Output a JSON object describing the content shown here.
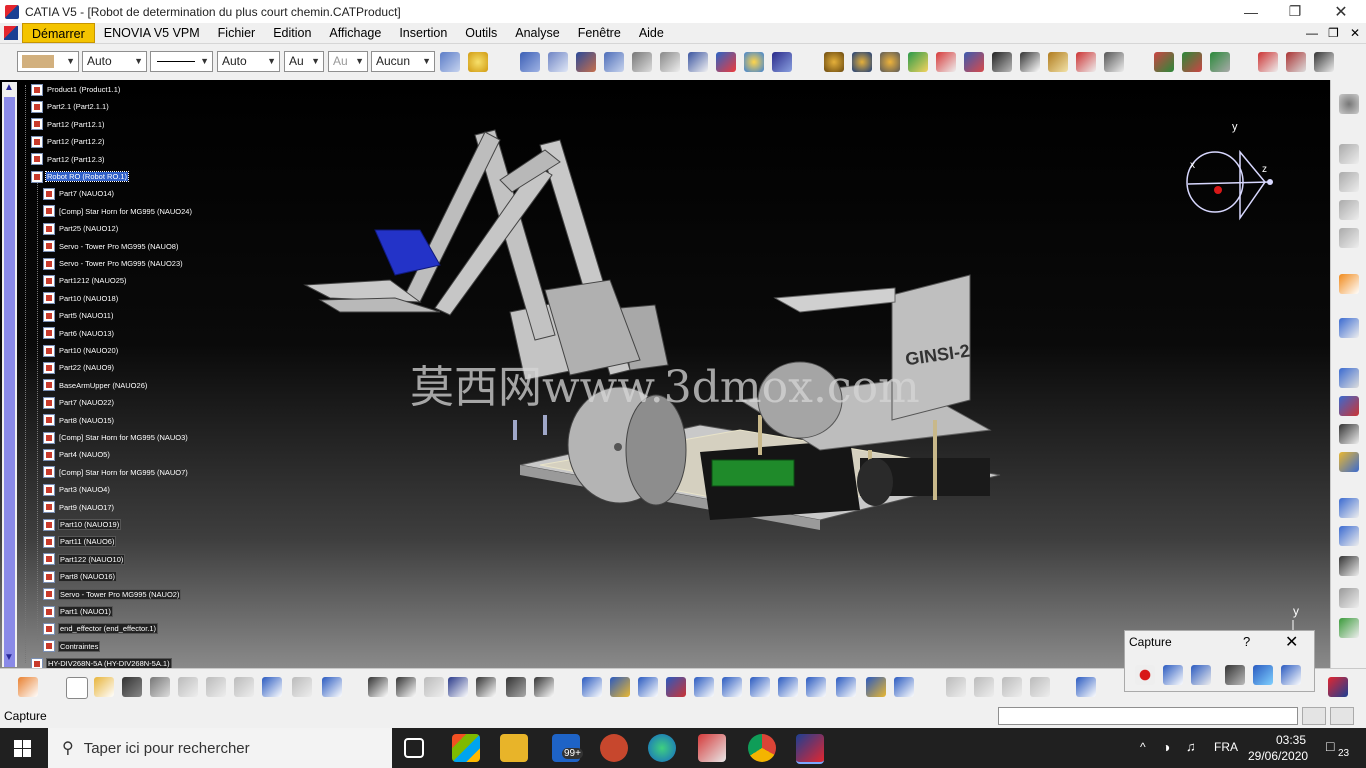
{
  "window": {
    "title": "CATIA V5 - [Robot de determination du plus court chemin.CATProduct]"
  },
  "menu": {
    "items": [
      "Démarrer",
      "ENOVIA V5 VPM",
      "Fichier",
      "Edition",
      "Affichage",
      "Insertion",
      "Outils",
      "Analyse",
      "Fenêtre",
      "Aide"
    ]
  },
  "toolbar": {
    "line_style": "Auto",
    "thickness": "Auto",
    "combo_a": "Au",
    "combo_b": "Au",
    "layer": "Aucun"
  },
  "tree": {
    "items": [
      "Product1 (Product1.1)",
      "Part2.1 (Part2.1.1)",
      "Part12 (Part12.1)",
      "Part12 (Part12.2)",
      "Part12 (Part12.3)",
      "Robot RO (Robot RO.1)",
      "Part7 (NAUO14)",
      "[Comp] Star Horn for MG995 (NAUO24)",
      "Part25 (NAUO12)",
      "Servo - Tower Pro MG995 (NAUO8)",
      "Servo - Tower Pro MG995 (NAUO23)",
      "Part1212 (NAUO25)",
      "Part10 (NAUO18)",
      "Part5 (NAUO11)",
      "Part6 (NAUO13)",
      "Part10 (NAUO20)",
      "Part22 (NAUO9)",
      "BaseArmUpper (NAUO26)",
      "Part7 (NAUO22)",
      "Part8 (NAUO15)",
      "[Comp] Star Horn for MG995 (NAUO3)",
      "Part4 (NAUO5)",
      "[Comp] Star Horn for MG995 (NAUO7)",
      "Part3 (NAUO4)",
      "Part9 (NAUO17)",
      "Part10 (NAUO19)",
      "Part11 (NAUO6)",
      "Part122 (NAUO10)",
      "Part8 (NAUO16)",
      "Servo - Tower Pro MG995 (NAUO2)",
      "Part1 (NAUO1)",
      "end_effector (end_effector.1)",
      "Contraintes",
      "HY-DIV268N-5A (HY-DIV268N-5A.1)"
    ]
  },
  "viewport": {
    "watermark": "莫西网www.3dmox.com",
    "board_label": "GINSI-2",
    "compass": {
      "x": "x",
      "y": "y",
      "z": "z"
    },
    "axis_y": "y"
  },
  "capture_toolbar": {
    "title": "Capture",
    "help": "?",
    "close": "✕"
  },
  "status": {
    "text": "Capture"
  },
  "taskbar": {
    "search_placeholder": "Taper ici pour rechercher",
    "mail_badge": "99+",
    "language": "FRA",
    "time": "03:35",
    "date": "29/06/2020",
    "notifications": "23"
  },
  "colors": {
    "menu_active": "#f4c400",
    "tree_selection": "#3060c8",
    "scrollbar_thumb": "#8a8ae8",
    "taskbar": "#202020"
  }
}
